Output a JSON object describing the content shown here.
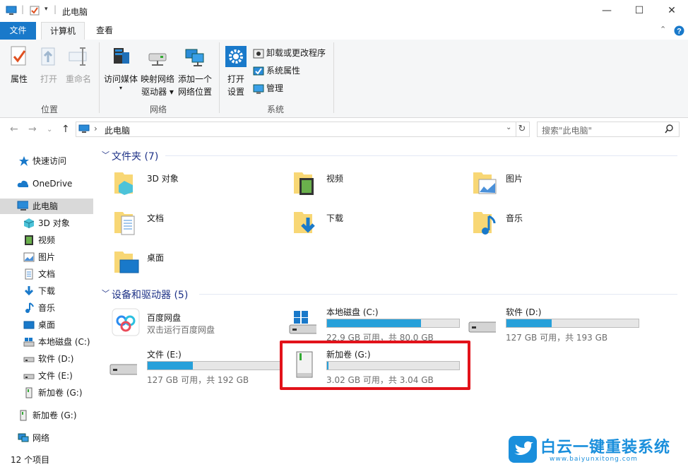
{
  "window": {
    "title": "此电脑",
    "controls": {
      "minimize": "—",
      "maximize": "☐",
      "close": "✕"
    }
  },
  "ribbon_tabs": {
    "file": "文件",
    "computer": "计算机",
    "view": "查看"
  },
  "ribbon": {
    "location_group": {
      "label": "位置",
      "properties": "属性",
      "open": "打开",
      "rename": "重命名"
    },
    "network_group": {
      "label": "网络",
      "access_media_1": "访问媒体",
      "map_drive_1": "映射网络",
      "map_drive_2": "驱动器",
      "add_location_1": "添加一个",
      "add_location_2": "网络位置"
    },
    "system_group": {
      "label": "系统",
      "open_settings_1": "打开",
      "open_settings_2": "设置",
      "uninstall": "卸载或更改程序",
      "sys_props": "系统属性",
      "manage": "管理"
    }
  },
  "address": {
    "path": "此电脑",
    "search_placeholder": "搜索\"此电脑\""
  },
  "nav": {
    "quick_access": "快速访问",
    "onedrive": "OneDrive",
    "this_pc": "此电脑",
    "items": [
      "3D 对象",
      "视频",
      "图片",
      "文档",
      "下载",
      "音乐",
      "桌面",
      "本地磁盘 (C:)",
      "软件 (D:)",
      "文件 (E:)",
      "新加卷 (G:)"
    ],
    "new_vol": "新加卷 (G:)",
    "network": "网络"
  },
  "folders_group": {
    "header": "文件夹 (7)",
    "items": [
      "3D 对象",
      "视频",
      "图片",
      "文档",
      "下载",
      "音乐",
      "桌面"
    ]
  },
  "drives_group": {
    "header": "设备和驱动器 (5)",
    "baidu": {
      "name": "百度网盘",
      "desc": "双击运行百度网盘"
    },
    "drives": [
      {
        "name": "本地磁盘 (C:)",
        "info": "22.9 GB 可用，共 80.0 GB",
        "used_fraction": 0.71
      },
      {
        "name": "软件 (D:)",
        "info": "127 GB 可用，共 193 GB",
        "used_fraction": 0.34
      },
      {
        "name": "文件 (E:)",
        "info": "127 GB 可用，共 192 GB",
        "used_fraction": 0.34
      },
      {
        "name": "新加卷 (G:)",
        "info": "3.02 GB 可用，共 3.04 GB",
        "used_fraction": 0.01
      }
    ]
  },
  "status": {
    "count": "12 个项目"
  },
  "watermark": {
    "brand": "白云一键重装系统",
    "url": "www.baiyunxitong.com"
  },
  "colors": {
    "accent": "#1979ca",
    "bar_fill": "#26a0da",
    "highlight": "#e2121a",
    "group_header": "#1e3287"
  }
}
